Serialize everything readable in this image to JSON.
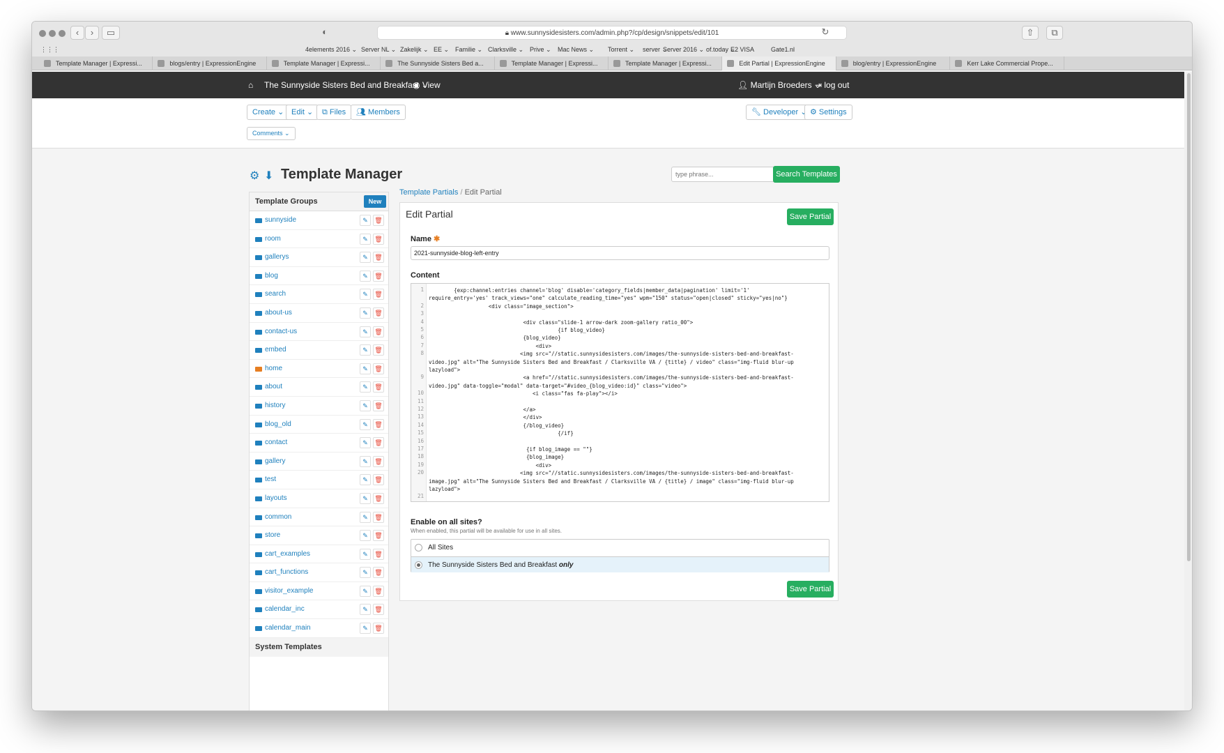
{
  "browser": {
    "url": "www.sunnysidesisters.com/admin.php?/cp/design/snippets/edit/101",
    "bookmarks": [
      "4elements 2016 ⌄",
      "Server NL ⌄",
      "Zakelijk ⌄",
      "EE ⌄",
      "Familie ⌄",
      "Clarksville ⌄",
      "Prive ⌄",
      "Mac News ⌄",
      "Torrent ⌄",
      "server ⌄",
      "Server 2016 ⌄",
      "of.today ⌄",
      "E2 VISA",
      "Gate1.nl"
    ],
    "tabs": [
      "Template Manager | Expressi...",
      "blogs/entry | ExpressionEngine",
      "Template Manager | Expressi...",
      "The Sunnyside Sisters Bed a...",
      "Template Manager | Expressi...",
      "Template Manager | Expressi...",
      "Edit Partial | ExpressionEngine",
      "blog/entry | ExpressionEngine",
      "Kerr Lake Commercial Prope..."
    ]
  },
  "topbar": {
    "site_name": "The Sunnyside Sisters Bed and Breakfast",
    "view": "View",
    "user": "Martijn Broeders",
    "logout": "log out"
  },
  "menu": {
    "create": "Create",
    "edit": "Edit",
    "files": "Files",
    "members": "Members",
    "comments": "Comments",
    "developer": "Developer",
    "settings": "Settings"
  },
  "page": {
    "title": "Template Manager",
    "search_placeholder": "type phrase...",
    "search_button": "Search Templates"
  },
  "sidebar": {
    "heading": "Template Groups",
    "new_label": "New",
    "groups": [
      "sunnyside",
      "room",
      "gallerys",
      "blog",
      "search",
      "about-us",
      "contact-us",
      "embed",
      "home",
      "about",
      "history",
      "blog_old",
      "contact",
      "gallery",
      "test",
      "layouts",
      "common",
      "store",
      "cart_examples",
      "cart_functions",
      "visitor_example",
      "calendar_inc",
      "calendar_main"
    ],
    "system_heading": "System Templates"
  },
  "breadcrumb": {
    "parent": "Template Partials",
    "current": "Edit Partial"
  },
  "form": {
    "title": "Edit Partial",
    "save_label": "Save Partial",
    "name_label": "Name",
    "name_value": "2021-sunnyside-blog-left-entry",
    "content_label": "Content",
    "code_lines": [
      {
        "n": "1",
        "text": "        {exp:channel:entries channel='blog' disable='category_fields|member_data|pagination' limit='1'"
      },
      {
        "n": "",
        "text": "require_entry='yes' track_views=\"one\" calculate_reading_time=\"yes\" wpm=\"150\" status=\"open|closed\" sticky=\"yes|no\"}"
      },
      {
        "n": "2",
        "text": "                   <div class=\"image_section\">"
      },
      {
        "n": "3",
        "text": ""
      },
      {
        "n": "4",
        "text": "                              <div class=\"slide-1 arrow-dark zoom-gallery ratio_00\">"
      },
      {
        "n": "5",
        "text": "                                         {if blog_video}"
      },
      {
        "n": "6",
        "text": "                              {blog_video}"
      },
      {
        "n": "7",
        "text": "                                  <div>"
      },
      {
        "n": "8",
        "text": "                             <img src=\"//static.sunnysidesisters.com/images/the-sunnyside-sisters-bed-and-breakfast-"
      },
      {
        "n": "",
        "text": "video.jpg\" alt=\"The Sunnyside Sisters Bed and Breakfast / Clarksville VA / {title} / video\" class=\"img-fluid blur-up"
      },
      {
        "n": "",
        "text": "lazyload\">"
      },
      {
        "n": "9",
        "text": "                              <a href=\"//static.sunnysidesisters.com/images/the-sunnyside-sisters-bed-and-breakfast-"
      },
      {
        "n": "",
        "text": "video.jpg\" data-toggle=\"modal\" data-target=\"#video_{blog_video:id}\" class=\"video\">"
      },
      {
        "n": "10",
        "text": "                                 <i class=\"fas fa-play\"></i>"
      },
      {
        "n": "11",
        "text": ""
      },
      {
        "n": "12",
        "text": "                              </a>"
      },
      {
        "n": "13",
        "text": "                              </div>"
      },
      {
        "n": "14",
        "text": "                              {/blog_video}"
      },
      {
        "n": "15",
        "text": "                                         {/if}"
      },
      {
        "n": "16",
        "text": ""
      },
      {
        "n": "17",
        "text": "                               {if blog_image == \"\"}"
      },
      {
        "n": "18",
        "text": "                               {blog_image}"
      },
      {
        "n": "19",
        "text": "                                  <div>"
      },
      {
        "n": "20",
        "text": "                             <img src=\"//static.sunnysidesisters.com/images/the-sunnyside-sisters-bed-and-breakfast-"
      },
      {
        "n": "",
        "text": "image.jpg\" alt=\"The Sunnyside Sisters Bed and Breakfast / Clarksville VA / {title} / image\" class=\"img-fluid blur-up"
      },
      {
        "n": "",
        "text": "lazyload\">"
      },
      {
        "n": "21",
        "text": ""
      }
    ],
    "enable_label": "Enable on all sites?",
    "enable_help": "When enabled, this partial will be available for use in all sites.",
    "option_all": "All Sites",
    "option_site": "The Sunnyside Sisters Bed and Breakfast",
    "option_site_suffix": "only"
  },
  "colors": {
    "accent": "#1f80bd",
    "save_green": "#27ae60",
    "topbar": "#333333",
    "delete_red": "#e74c3c"
  }
}
